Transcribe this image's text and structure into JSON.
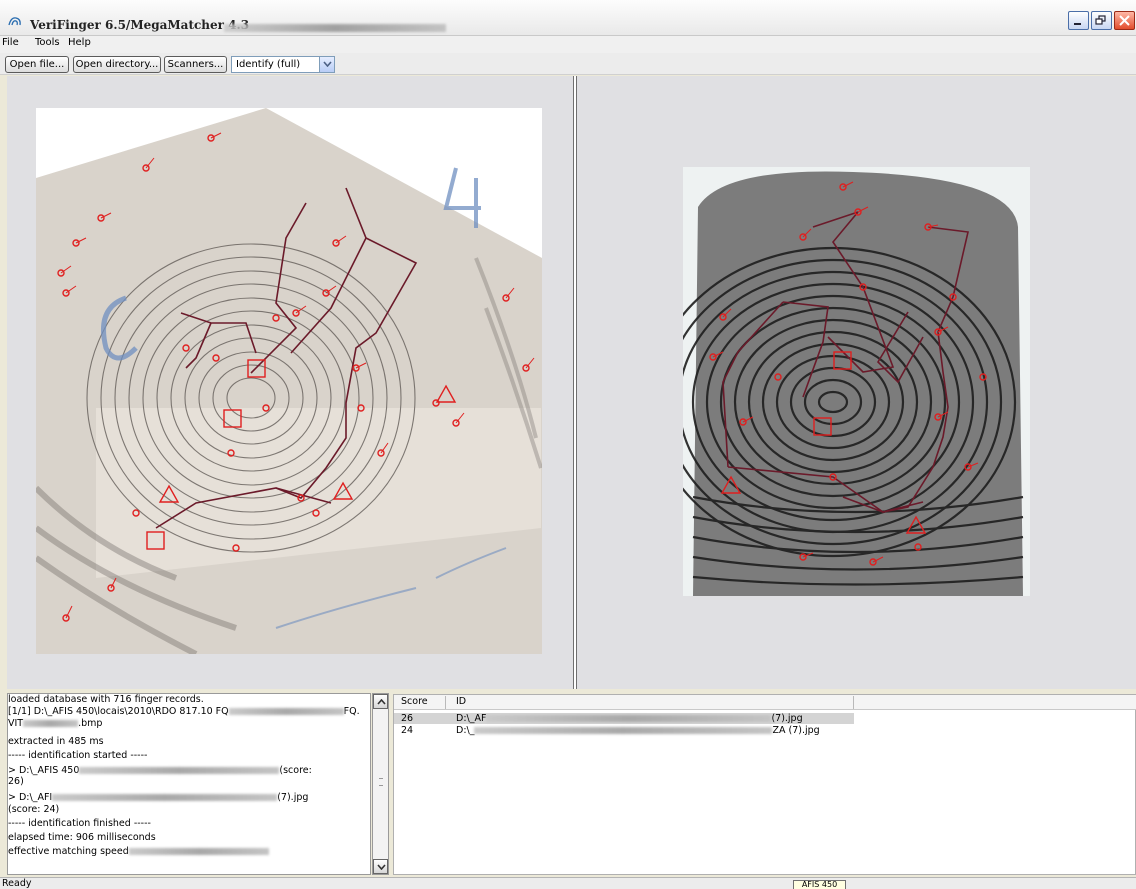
{
  "window": {
    "title": "VeriFinger 6.5/MegaMatcher 4.3",
    "controls": [
      "minimize-icon",
      "restore-icon",
      "close-icon"
    ]
  },
  "menu": {
    "file": "File",
    "tools": "Tools",
    "help": "Help"
  },
  "toolbar": {
    "open_file": "Open file...",
    "open_directory": "Open directory...",
    "scanners": "Scanners...",
    "mode_select": "Identify (full)"
  },
  "log": {
    "lines": [
      "loaded database with 716 finger records.",
      "[1/1] D:\\_AFIS 450\\locais\\2010\\RDO 817.10 FQ",
      ".bmp",
      "extracted in 485 ms",
      "----- identification started -----",
      "> D:\\_AFIS 450",
      "26)",
      "> D:\\_AFI",
      "(score: 24)",
      "----- identification finished -----",
      "elapsed time: 906 milliseconds",
      "effective matching speed"
    ],
    "line2_tail": "FQ.",
    "line3_prefix": "VIT",
    "line6_tail": "(score:",
    "line8_tail": "(7).jpg"
  },
  "results": {
    "columns": [
      "Score",
      "ID"
    ],
    "rows": [
      {
        "score": "26",
        "id_prefix": "D:\\_AF",
        "id_suffix": "(7).jpg"
      },
      {
        "score": "24",
        "id_prefix": "D:\\_",
        "id_suffix": "ZA (7).jpg"
      }
    ]
  },
  "status": {
    "text": "Ready",
    "badge": "AFIS 450"
  },
  "colors": {
    "minutia_red": "#e01f1f",
    "match_line": "#6b1a2a",
    "selection_gray": "#d4d4d4"
  }
}
